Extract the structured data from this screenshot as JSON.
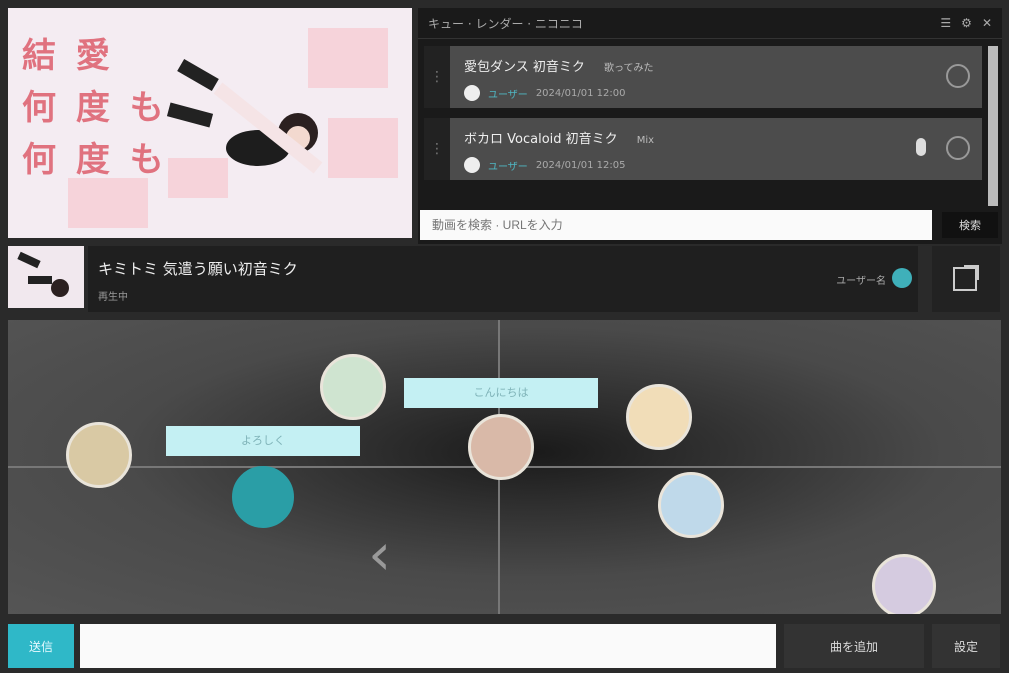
{
  "video": {
    "title_lines": [
      "結 愛",
      "何 度 も",
      "何 度 も"
    ]
  },
  "queue": {
    "header_title": "キュー · レンダー · ニコニコ",
    "items": [
      {
        "title": "愛包ダンス 初音ミク",
        "tag": "歌ってみた",
        "user": "ユーザー",
        "meta": "2024/01/01 12:00"
      },
      {
        "title": "ボカロ Vocaloid 初音ミク",
        "tag": "Mix",
        "user": "ユーザー",
        "meta": "2024/01/01 12:05"
      }
    ],
    "search": {
      "placeholder": "動画を検索 · URLを入力",
      "button_label": "検索"
    }
  },
  "now_playing": {
    "title": "キミトミ 気遣う願い初音ミク",
    "subtitle": "再生中",
    "user": "ユーザー名"
  },
  "room": {
    "bubbles": [
      {
        "text": "よろしく"
      },
      {
        "text": "こんにちは"
      }
    ],
    "users": [
      {
        "color": "#d9c9a4"
      },
      {
        "color": "#cfe4d0"
      },
      {
        "color": "#d9b9a8"
      },
      {
        "color": "#f1ddb8"
      },
      {
        "color": "#bfd9ea"
      },
      {
        "color": "#d5cbe0"
      },
      {
        "color": "#2a9ea6"
      }
    ]
  },
  "bottom": {
    "left_label": "送信",
    "chat_placeholder": "",
    "post_label": "曲を追加",
    "more_label": "設定"
  },
  "colors": {
    "accent": "#2fb8c8",
    "panel": "#1f1f1f",
    "bubble": "#c4f0f3"
  }
}
